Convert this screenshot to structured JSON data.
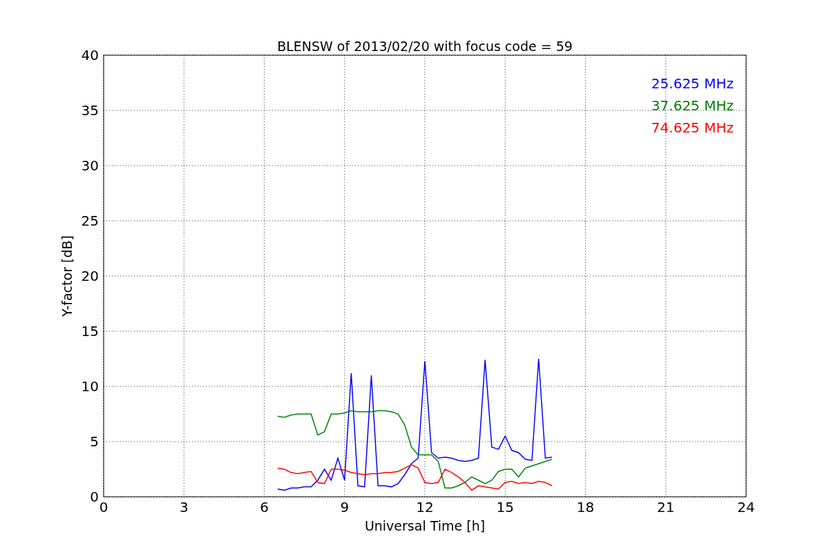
{
  "chart_data": {
    "type": "line",
    "title": "BLENSW of 2013/02/20 with focus code = 59",
    "xlabel": "Universal Time [h]",
    "ylabel": "Y-factor [dB]",
    "x": [
      6.5,
      6.75,
      7,
      7.25,
      7.5,
      7.75,
      8,
      8.25,
      8.5,
      8.75,
      9,
      9.25,
      9.5,
      9.75,
      10,
      10.25,
      10.5,
      10.75,
      11,
      11.25,
      11.5,
      11.75,
      12,
      12.25,
      12.5,
      12.75,
      13,
      13.25,
      13.5,
      13.75,
      14,
      14.25,
      14.5,
      14.75,
      15,
      15.25,
      15.5,
      15.75,
      16,
      16.25,
      16.5,
      16.75
    ],
    "series": [
      {
        "name": "25.625 MHz",
        "color": "#0000ff",
        "values": [
          0.7,
          0.6,
          0.8,
          0.8,
          0.9,
          0.9,
          1.5,
          2.5,
          1.5,
          3.5,
          1.5,
          11.2,
          1.0,
          0.9,
          11.0,
          1.0,
          1.0,
          0.9,
          1.2,
          2,
          3,
          3.5,
          12.3,
          4,
          3.5,
          3.6,
          3.5,
          3.3,
          3.2,
          3.3,
          3.5,
          12.4,
          4.5,
          4.3,
          5.5,
          4.2,
          4.0,
          3.4,
          3.3,
          12.5,
          3.5,
          3.6
        ]
      },
      {
        "name": "37.625 MHz",
        "color": "#008000",
        "values": [
          7.3,
          7.2,
          7.4,
          7.5,
          7.5,
          7.5,
          5.6,
          5.9,
          7.5,
          7.5,
          7.6,
          7.8,
          7.7,
          7.7,
          7.7,
          7.8,
          7.8,
          7.7,
          7.5,
          6.5,
          4.5,
          3.8,
          3.8,
          3.8,
          3.2,
          0.8,
          0.8,
          1.0,
          1.3,
          1.8,
          1.5,
          1.2,
          1.5,
          2.3,
          2.5,
          2.5,
          1.8,
          2.6,
          2.8,
          3.0,
          3.2,
          3.4
        ]
      },
      {
        "name": "74.625 MHz",
        "color": "#ff0000",
        "values": [
          2.6,
          2.5,
          2.2,
          2.1,
          2.2,
          2.3,
          1.3,
          1.2,
          2.5,
          2.5,
          2.4,
          2.2,
          2.1,
          2.0,
          2.1,
          2.1,
          2.2,
          2.2,
          2.3,
          2.6,
          2.9,
          2.6,
          1.3,
          1.2,
          1.3,
          2.5,
          2.2,
          1.8,
          1.3,
          0.6,
          1.0,
          0.9,
          0.8,
          0.7,
          1.3,
          1.4,
          1.2,
          1.3,
          1.2,
          1.4,
          1.3,
          1.0
        ]
      }
    ],
    "grid": true,
    "xlim": [
      0,
      24
    ],
    "ylim": [
      0,
      40
    ],
    "xticks": [
      0,
      3,
      6,
      9,
      12,
      15,
      18,
      21,
      24
    ],
    "yticks": [
      0,
      5,
      10,
      15,
      20,
      25,
      30,
      35,
      40
    ]
  }
}
